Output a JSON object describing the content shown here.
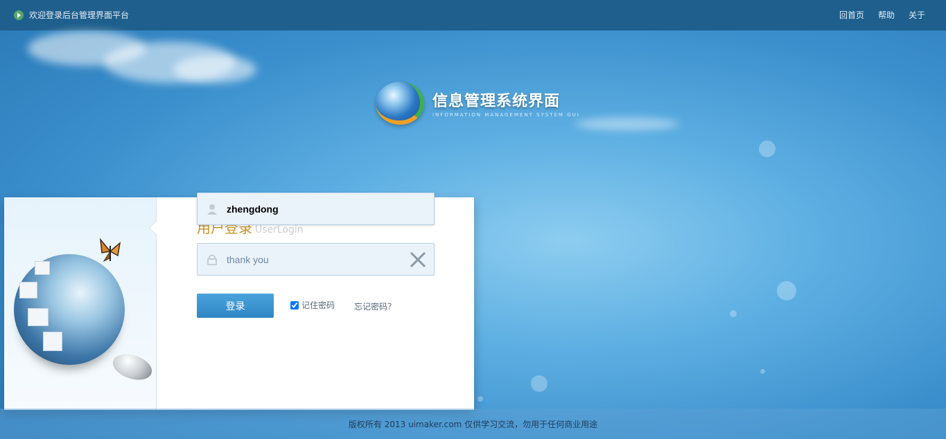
{
  "topbar": {
    "welcome_text": "欢迎登录后台管理界面平台",
    "nav": [
      "回首页",
      "帮助",
      "关于"
    ]
  },
  "logo": {
    "title": "信息管理系统界面",
    "subtitle": "INFORMATION MANAGEMENT SYSTEM GUI"
  },
  "login": {
    "title_cn": "用户登录",
    "title_en": "UserLogin",
    "username_value": "zhengdong",
    "password_value": "thank you",
    "login_button": "登录",
    "remember_label": "记住密码",
    "remember_checked": true,
    "forgot_label": "忘记密码？"
  },
  "footer": {
    "copyright": "版权所有 2013 uimaker.com 仅供学习交流，勿用于任何商业用途"
  },
  "colors": {
    "topbar": "#1e5f8d",
    "accent_button": "#3a93d0",
    "title_gold": "#c79020"
  }
}
